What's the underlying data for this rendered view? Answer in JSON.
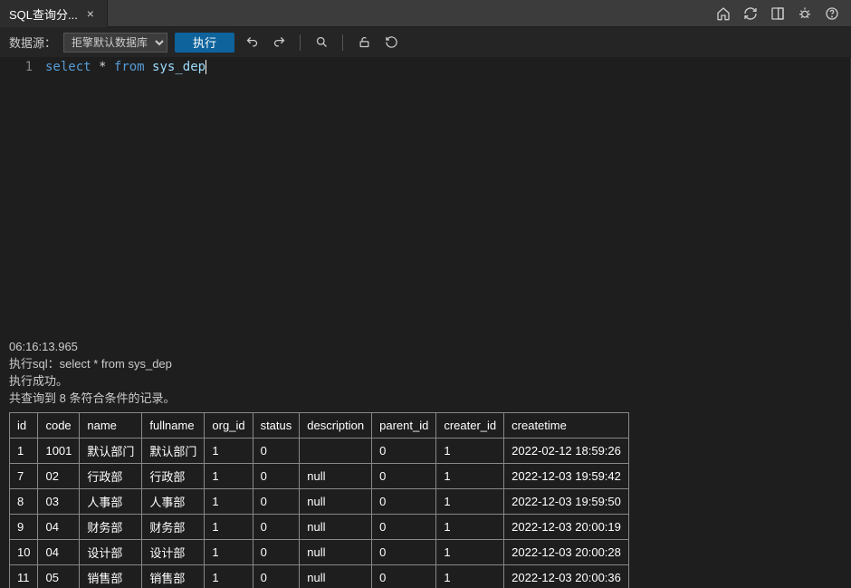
{
  "tab": {
    "title": "SQL查询分...",
    "closeable": true
  },
  "toolbar": {
    "datasource_label": "数据源：",
    "datasource_value": "拒擎默认数据库",
    "execute_label": "执行"
  },
  "editor": {
    "line_number": "1",
    "code": {
      "kw1": "select",
      "op1": "*",
      "kw2": "from",
      "ident": "sys_dep"
    }
  },
  "log": {
    "time": "06:16:13.965",
    "line1": "执行sql：select * from sys_dep",
    "line2": "执行成功。",
    "line3": "共查询到 8 条符合条件的记录。"
  },
  "table": {
    "headers": [
      "id",
      "code",
      "name",
      "fullname",
      "org_id",
      "status",
      "description",
      "parent_id",
      "creater_id",
      "createtime"
    ],
    "rows": [
      {
        "id": "1",
        "code": "1001",
        "name": "默认部门",
        "fullname": "默认部门",
        "org_id": "1",
        "status": "0",
        "description": "",
        "parent_id": "0",
        "creater_id": "1",
        "createtime": "2022-02-12 18:59:26"
      },
      {
        "id": "7",
        "code": "02",
        "name": "行政部",
        "fullname": "行政部",
        "org_id": "1",
        "status": "0",
        "description": "null",
        "parent_id": "0",
        "creater_id": "1",
        "createtime": "2022-12-03 19:59:42"
      },
      {
        "id": "8",
        "code": "03",
        "name": "人事部",
        "fullname": "人事部",
        "org_id": "1",
        "status": "0",
        "description": "null",
        "parent_id": "0",
        "creater_id": "1",
        "createtime": "2022-12-03 19:59:50"
      },
      {
        "id": "9",
        "code": "04",
        "name": "财务部",
        "fullname": "财务部",
        "org_id": "1",
        "status": "0",
        "description": "null",
        "parent_id": "0",
        "creater_id": "1",
        "createtime": "2022-12-03 20:00:19"
      },
      {
        "id": "10",
        "code": "04",
        "name": "设计部",
        "fullname": "设计部",
        "org_id": "1",
        "status": "0",
        "description": "null",
        "parent_id": "0",
        "creater_id": "1",
        "createtime": "2022-12-03 20:00:28"
      },
      {
        "id": "11",
        "code": "05",
        "name": "销售部",
        "fullname": "销售部",
        "org_id": "1",
        "status": "0",
        "description": "null",
        "parent_id": "0",
        "creater_id": "1",
        "createtime": "2022-12-03 20:00:36"
      }
    ]
  }
}
